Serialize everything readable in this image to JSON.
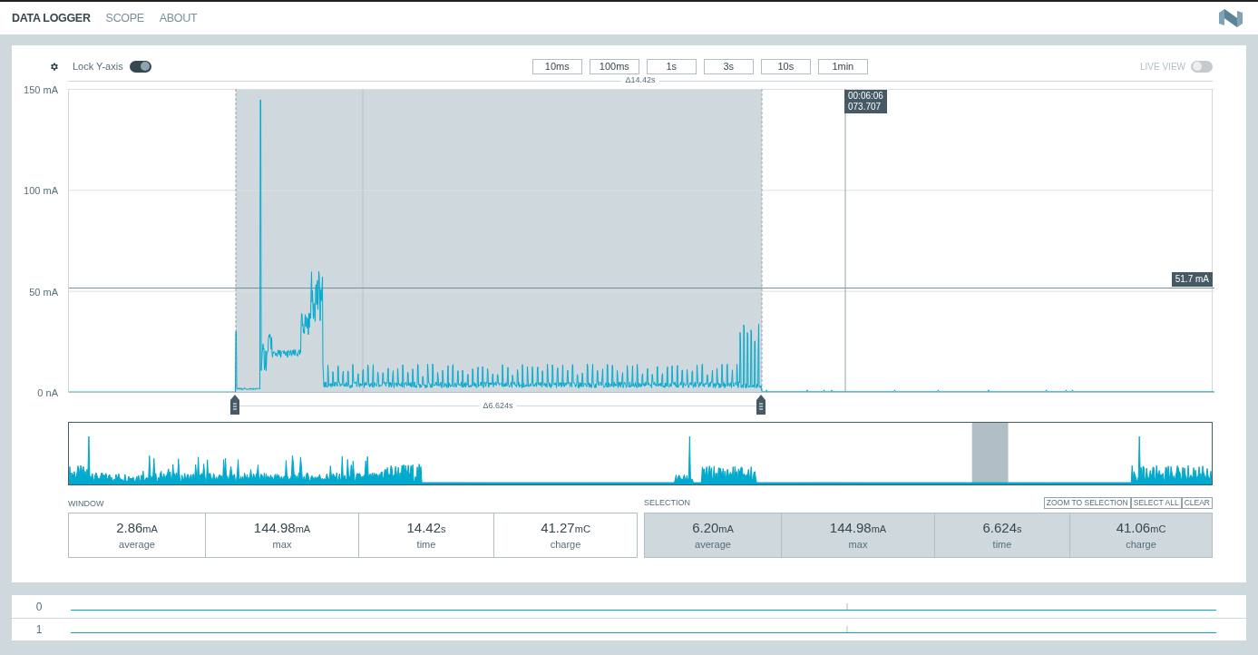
{
  "nav": {
    "tabs": [
      {
        "label": "DATA LOGGER",
        "selected": true
      },
      {
        "label": "SCOPE",
        "selected": false
      },
      {
        "label": "ABOUT",
        "selected": false
      }
    ]
  },
  "toolbar": {
    "lock_y_axis": {
      "label": "Lock Y-axis",
      "on": true
    },
    "zoom_buttons": [
      "10ms",
      "100ms",
      "1s",
      "3s",
      "10s",
      "1min"
    ],
    "live_view": {
      "label": "LIVE VIEW",
      "on": false
    }
  },
  "chart": {
    "window_delta": "Δ14.42s",
    "y_axis_labels": [
      "150 mA",
      "100 mA",
      "50 mA",
      "0 nA"
    ],
    "cursor_label": [
      "00:06:06",
      "073.707"
    ],
    "value_label": "51.7 mA",
    "selection_delta": "Δ6.624s"
  },
  "window": {
    "title": "WINDOW",
    "stats": [
      {
        "value": "2.86",
        "unit": "mA",
        "label": "average"
      },
      {
        "value": "144.98",
        "unit": "mA",
        "label": "max"
      },
      {
        "value": "14.42",
        "unit": "s",
        "label": "time"
      },
      {
        "value": "41.27",
        "unit": "mC",
        "label": "charge"
      }
    ]
  },
  "selection": {
    "title": "SELECTION",
    "actions": [
      "ZOOM TO SELECTION",
      "SELECT ALL",
      "CLEAR"
    ],
    "stats": [
      {
        "value": "6.20",
        "unit": "mA",
        "label": "average"
      },
      {
        "value": "144.98",
        "unit": "mA",
        "label": "max"
      },
      {
        "value": "6.624",
        "unit": "s",
        "label": "time"
      },
      {
        "value": "41.06",
        "unit": "mC",
        "label": "charge"
      }
    ]
  },
  "digital_channels": [
    "0",
    "1"
  ]
}
